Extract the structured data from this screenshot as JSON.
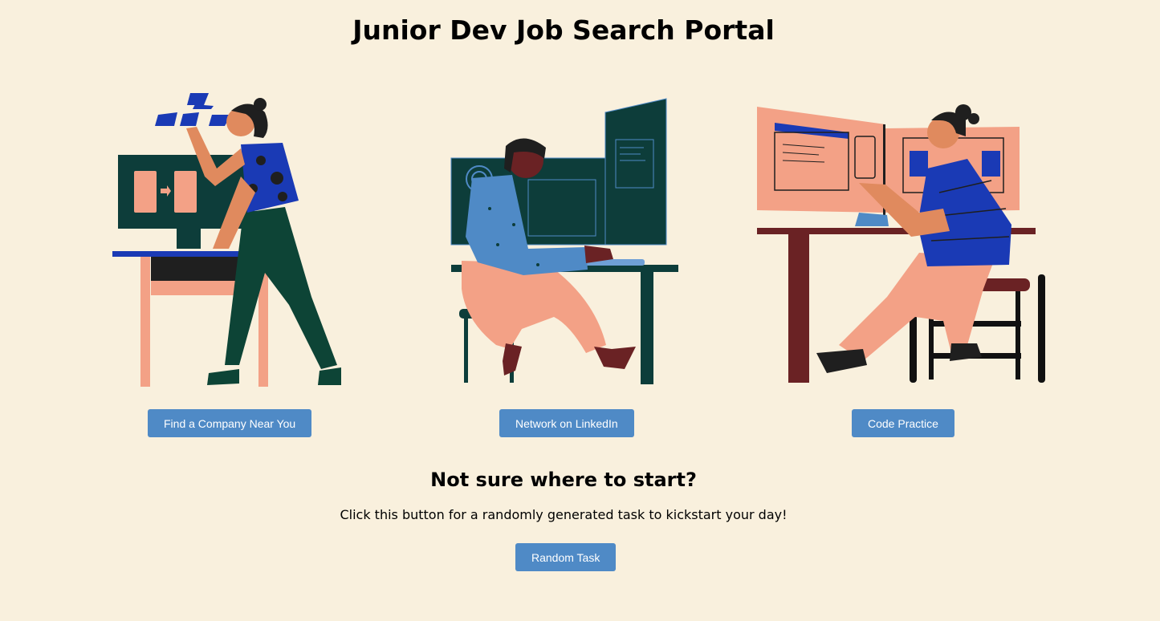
{
  "header": {
    "title": "Junior Dev Job Search Portal"
  },
  "cards": [
    {
      "button_label": "Find a Company Near You",
      "illustration": "woman-arranging-blocks-at-computer"
    },
    {
      "button_label": "Network on LinkedIn",
      "illustration": "woman-seated-at-dual-monitor-desk"
    },
    {
      "button_label": "Code Practice",
      "illustration": "woman-pointing-at-screens-on-stool"
    }
  ],
  "random": {
    "heading": "Not sure where to start?",
    "description": "Click this button for a randomly generated task to kickstart your day!",
    "button_label": "Random Task"
  },
  "colors": {
    "background": "#f9f0dd",
    "button": "#4f8ac6",
    "dark_green": "#0d3d3a",
    "salmon": "#f3a186",
    "royal_blue": "#1a3ab5",
    "maroon": "#6a2224"
  }
}
